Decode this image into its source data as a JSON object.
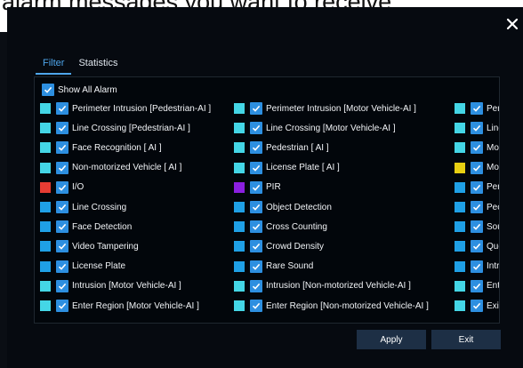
{
  "banner": {
    "text": "alarm messages you want to receive."
  },
  "tabs": [
    {
      "label": "Filter",
      "active": true
    },
    {
      "label": "Statistics",
      "active": false
    }
  ],
  "show_all": {
    "label": "Show All Alarm",
    "checked": true
  },
  "columns": [
    [
      {
        "color": "#44d6e6",
        "label": "Perimeter Intrusion [Pedestrian-AI ]"
      },
      {
        "color": "#44d6e6",
        "label": "Line Crossing [Pedestrian-AI ]"
      },
      {
        "color": "#44d6e6",
        "label": "Face Recognition  [ AI ]"
      },
      {
        "color": "#44d6e6",
        "label": "Non-motorized Vehicle  [ AI ]"
      },
      {
        "color": "#e63c33",
        "label": "I/O"
      },
      {
        "color": "#1fa0e6",
        "label": "Line Crossing"
      },
      {
        "color": "#1fa0e6",
        "label": "Face Detection"
      },
      {
        "color": "#1fa0e6",
        "label": "Video Tampering"
      },
      {
        "color": "#1fa0e6",
        "label": "License Plate"
      },
      {
        "color": "#44d6e6",
        "label": "Intrusion [Motor Vehicle-AI ]"
      },
      {
        "color": "#44d6e6",
        "label": "Enter Region [Motor Vehicle-AI ]"
      }
    ],
    [
      {
        "color": "#44d6e6",
        "label": "Perimeter Intrusion [Motor Vehicle-AI ]"
      },
      {
        "color": "#44d6e6",
        "label": "Line Crossing [Motor Vehicle-AI ]"
      },
      {
        "color": "#44d6e6",
        "label": "Pedestrian  [ AI ]"
      },
      {
        "color": "#44d6e6",
        "label": "License Plate  [ AI ]"
      },
      {
        "color": "#8b1fe0",
        "label": "PIR"
      },
      {
        "color": "#1fa0e6",
        "label": "Object Detection"
      },
      {
        "color": "#1fa0e6",
        "label": "Cross Counting"
      },
      {
        "color": "#1fa0e6",
        "label": "Crowd Density"
      },
      {
        "color": "#1fa0e6",
        "label": "Rare Sound"
      },
      {
        "color": "#44d6e6",
        "label": "Intrusion [Non-motorized Vehicle-AI ]"
      },
      {
        "color": "#44d6e6",
        "label": "Enter Region [Non-motorized Vehicle-AI ]"
      }
    ],
    [
      {
        "color": "#44d6e6",
        "label": "Per"
      },
      {
        "color": "#44d6e6",
        "label": "Line"
      },
      {
        "color": "#44d6e6",
        "label": "Mo"
      },
      {
        "color": "#e8cf12",
        "label": "Mo"
      },
      {
        "color": "#1fa0e6",
        "label": "Per"
      },
      {
        "color": "#1fa0e6",
        "label": "Pec"
      },
      {
        "color": "#1fa0e6",
        "label": "Sou"
      },
      {
        "color": "#1fa0e6",
        "label": "Que"
      },
      {
        "color": "#1fa0e6",
        "label": "Intr"
      },
      {
        "color": "#44d6e6",
        "label": "Ent"
      },
      {
        "color": "#44d6e6",
        "label": "Exi"
      }
    ]
  ],
  "buttons": {
    "apply": "Apply",
    "exit": "Exit"
  },
  "icons": {
    "close": "close-icon",
    "checkbox": "checkmark-icon"
  },
  "colors": {
    "accent": "#2d8fe0",
    "button_bg": "#1d2f45"
  }
}
